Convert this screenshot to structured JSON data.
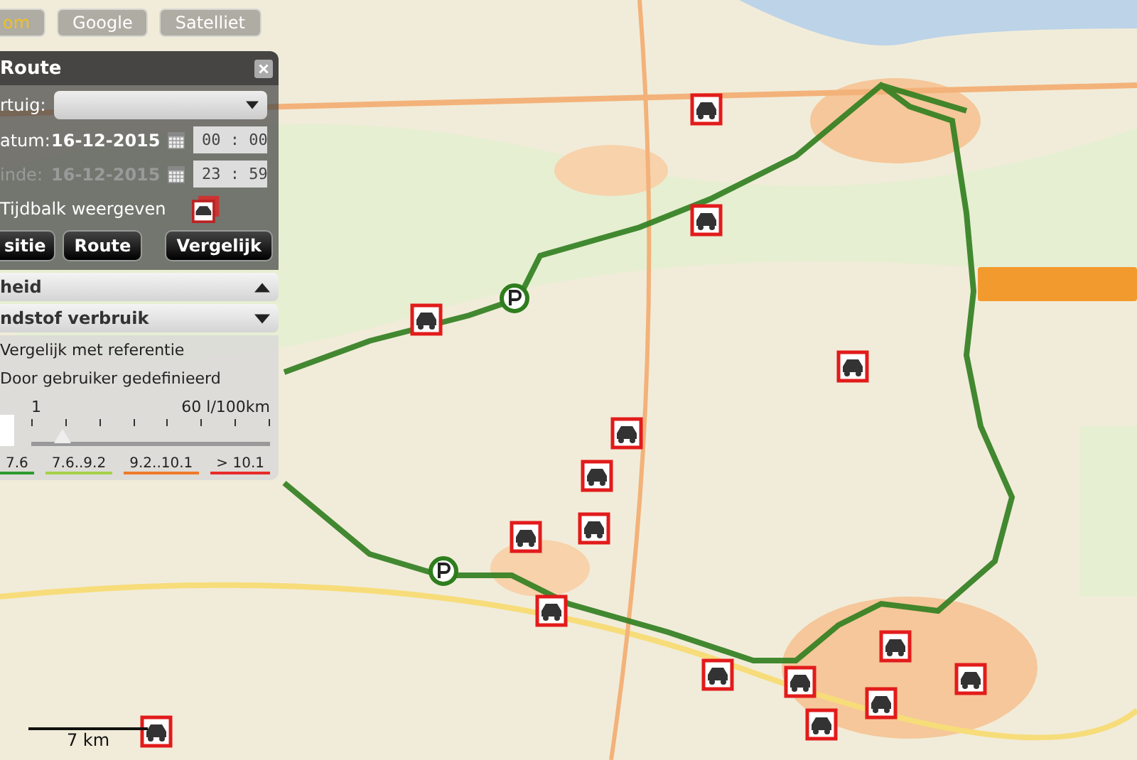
{
  "map_controls": [
    {
      "label": "om",
      "selected": true
    },
    {
      "label": "Google",
      "selected": false
    },
    {
      "label": "Satelliet",
      "selected": false
    }
  ],
  "panel": {
    "title": "Route",
    "vehicle": {
      "label": "rtuig:"
    },
    "periods": [
      {
        "label": "atum:",
        "date": "16-12-2015",
        "time": "00 : 00",
        "disabled": false
      },
      {
        "label": "inde:",
        "date": "16-12-2015",
        "time": "23 : 59",
        "disabled": true
      }
    ],
    "timebar": {
      "label": "Tijdbalk weergeven"
    },
    "buttons": [
      "sitie",
      "Route",
      "Vergelijk"
    ],
    "sections": [
      {
        "title": "heid",
        "expanded": false
      },
      {
        "title": "ndstof verbruik",
        "expanded": true
      }
    ],
    "options": [
      "Vergelijk met referentie",
      "Door gebruiker gedefinieerd"
    ],
    "slider": {
      "min": "1",
      "max": "60 l/100km",
      "level": 0.13
    },
    "legend": [
      {
        "label": "7.6",
        "color": "#2e9a2e"
      },
      {
        "label": "7.6..9.2",
        "color": "#a6d14a"
      },
      {
        "label": "9.2..10.1",
        "color": "#f07a2a"
      },
      {
        "label": "> 10.1",
        "color": "#e82a2a"
      }
    ]
  },
  "scale": {
    "label": "7 km"
  }
}
